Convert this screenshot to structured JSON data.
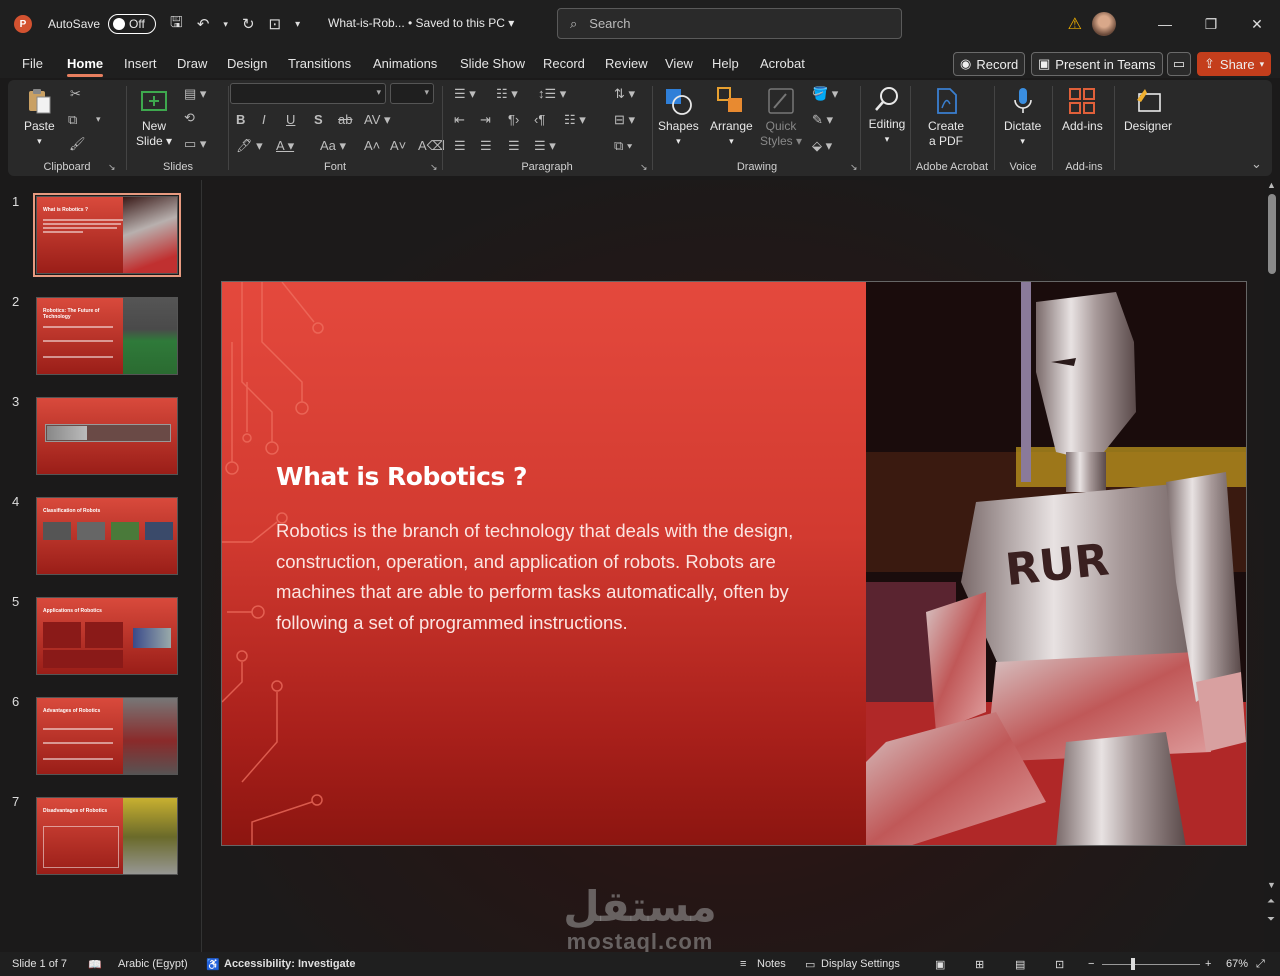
{
  "titlebar": {
    "autosave_label": "AutoSave",
    "autosave_state": "Off",
    "doc_title": "What-is-Rob... • Saved to this PC",
    "search_placeholder": "Search"
  },
  "menu": {
    "tabs": [
      "File",
      "Home",
      "Insert",
      "Draw",
      "Design",
      "Transitions",
      "Animations",
      "Slide Show",
      "Record",
      "Review",
      "View",
      "Help",
      "Acrobat"
    ],
    "active": "Home",
    "record_button": "Record",
    "teams_button": "Present in Teams",
    "share_button": "Share"
  },
  "ribbon": {
    "clipboard": {
      "paste": "Paste",
      "label": "Clipboard"
    },
    "slides": {
      "new_slide_1": "New",
      "new_slide_2": "Slide",
      "label": "Slides"
    },
    "font": {
      "label": "Font"
    },
    "paragraph": {
      "label": "Paragraph"
    },
    "drawing": {
      "shapes": "Shapes",
      "arrange": "Arrange",
      "quick_styles_1": "Quick",
      "quick_styles_2": "Styles",
      "label": "Drawing"
    },
    "editing": {
      "label": "Editing"
    },
    "acrobat": {
      "create_1": "Create",
      "create_2": "a PDF",
      "label": "Adobe Acrobat"
    },
    "voice": {
      "dictate": "Dictate",
      "label": "Voice"
    },
    "addins": {
      "addins": "Add-ins",
      "label": "Add-ins"
    },
    "designer": {
      "designer": "Designer"
    }
  },
  "thumbnails": [
    {
      "num": "1",
      "title": "What is Robotics ?"
    },
    {
      "num": "2",
      "title": "Robotics: The Future of Technology"
    },
    {
      "num": "3",
      "title": ""
    },
    {
      "num": "4",
      "title": "Classification of Robots"
    },
    {
      "num": "5",
      "title": "Applications of Robotics"
    },
    {
      "num": "6",
      "title": "Advantages of Robotics"
    },
    {
      "num": "7",
      "title": "Disadvantages of Robotics"
    }
  ],
  "slide": {
    "title": "What is Robotics ?",
    "body": "Robotics is the branch of technology that deals with the design, construction, operation, and application of robots. Robots are machines that are able to perform tasks automatically, often by following a set of programmed instructions.",
    "robot_chest_text": "RUR"
  },
  "status": {
    "slide_indicator": "Slide 1 of 7",
    "language": "Arabic (Egypt)",
    "accessibility": "Accessibility: Investigate",
    "notes": "Notes",
    "display_settings": "Display Settings",
    "zoom": "67%"
  },
  "watermark": {
    "arabic": "مستقل",
    "latin": "mostaql.com"
  },
  "colors": {
    "accent": "#e87f5f",
    "share": "#c43e1c",
    "slide_red": "#e4493d"
  }
}
